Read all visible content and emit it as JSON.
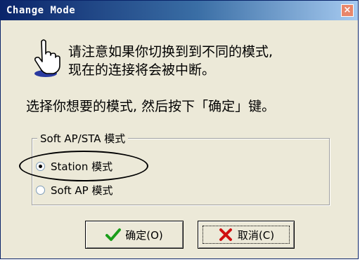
{
  "window": {
    "title": "Change Mode"
  },
  "titlebar": {
    "close_label": "×"
  },
  "message": {
    "line1": "请注意如果你切换到到不同的模式,",
    "line2": "现在的连接将会被中断。"
  },
  "instruction": "选择你想要的模式, 然后按下「确定」键。",
  "mode_group": {
    "legend": "Soft AP/STA 模式",
    "options": [
      {
        "label": "Station 模式",
        "selected": true
      },
      {
        "label": "Soft AP 模式",
        "selected": false
      }
    ]
  },
  "buttons": {
    "ok_label": "确定(O)",
    "cancel_label": "取消(C)"
  },
  "colors": {
    "ok_icon": "#1a9e1a",
    "cancel_icon": "#d01010"
  }
}
